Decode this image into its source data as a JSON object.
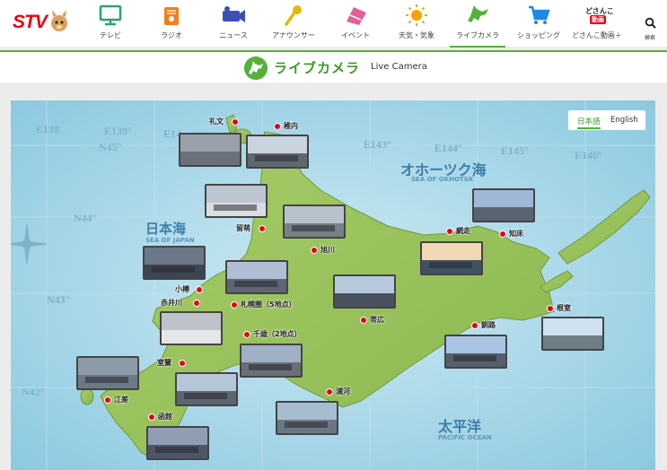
{
  "header": {
    "logo_text": "STV",
    "nav": [
      {
        "label": "テレビ",
        "icon": "tv-icon",
        "color": "#2aa36b"
      },
      {
        "label": "ラジオ",
        "icon": "radio-icon",
        "color": "#f07f1d"
      },
      {
        "label": "ニュース",
        "icon": "news-camera-icon",
        "color": "#3a4fb8"
      },
      {
        "label": "アナウンサー",
        "icon": "microphone-icon",
        "color": "#e6b800"
      },
      {
        "label": "イベント",
        "icon": "event-ticket-icon",
        "color": "#e65c9c"
      },
      {
        "label": "天気・気象",
        "icon": "sun-icon",
        "color": "#f5a300"
      },
      {
        "label": "ライブカメラ",
        "icon": "hokkaido-icon",
        "color": "#55b13a"
      },
      {
        "label": "ショッピング",
        "icon": "cart-icon",
        "color": "#1e88e5"
      }
    ],
    "doga_logo_line1": "どさんこ",
    "doga_logo_line2": "動画",
    "doga_label": "どさんこ動画＋",
    "search_label": "検索"
  },
  "page_title": {
    "jp": "ライブカメラ",
    "en": "Live Camera"
  },
  "language": {
    "jp": "日本語",
    "en": "English"
  },
  "map_labels": {
    "grid": [
      "E138",
      "E139°",
      "E14",
      "E143°",
      "E144°",
      "E145°",
      "E146°",
      "N45°",
      "N44°",
      "N43°",
      "N42°"
    ],
    "sea_okhotsk_jp": "オホーツク海",
    "sea_okhotsk_en": "SEA OF OKHOTSK",
    "sea_japan_jp": "日本海",
    "sea_japan_en": "SEA OF JAPAN",
    "pacific_jp": "太平洋",
    "pacific_en": "PACIFIC OCEAN"
  },
  "cameras": [
    {
      "name": "礼文",
      "sky": "#9aa0aa",
      "ground": "#6b6f78"
    },
    {
      "name": "稚内",
      "sky": "#c9d4e0",
      "ground": "#5f6770"
    },
    {
      "name": "留萌",
      "sky": "#bcc6d2",
      "ground": "#d9dde3"
    },
    {
      "name": "旭川",
      "sky": "#b8c2cc",
      "ground": "#7a8088"
    },
    {
      "name": "網走",
      "sky": "#f1d7b6",
      "ground": "#40525f"
    },
    {
      "name": "知床",
      "sky": "#9fb8d8",
      "ground": "#5a6470"
    },
    {
      "name": "小樽",
      "sky": "#6c7788",
      "ground": "#3e4552"
    },
    {
      "name": "赤井川",
      "sky": "#bfc3c9",
      "ground": "#e5e6e8"
    },
    {
      "name": "札幌圏（5地点）",
      "sky": "#aebfd5",
      "ground": "#5d6672"
    },
    {
      "name": "帯広",
      "sky": "#b7c9dd",
      "ground": "#4a5160"
    },
    {
      "name": "根室",
      "sky": "#cfe0ef",
      "ground": "#6f7d86"
    },
    {
      "name": "釧路",
      "sky": "#a9c4e2",
      "ground": "#55606c"
    },
    {
      "name": "千歳（2地点）",
      "sky": "#9fb0c4",
      "ground": "#6a7078"
    },
    {
      "name": "室蘭",
      "sky": "#b5c6d8",
      "ground": "#5d6570"
    },
    {
      "name": "江差",
      "sky": "#8d9aa8",
      "ground": "#6b7a86"
    },
    {
      "name": "浦河",
      "sky": "#a7bccf",
      "ground": "#6a7785"
    },
    {
      "name": "函館",
      "sky": "#8e9fb5",
      "ground": "#4d5664"
    }
  ]
}
